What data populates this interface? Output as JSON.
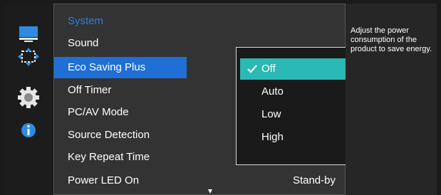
{
  "menu": {
    "header": "System",
    "items": [
      {
        "label": "Sound"
      },
      {
        "label": "Eco Saving Plus"
      },
      {
        "label": "Off Timer"
      },
      {
        "label": "PC/AV Mode"
      },
      {
        "label": "Source Detection"
      },
      {
        "label": "Key Repeat Time"
      },
      {
        "label": "Power LED On",
        "value": "Stand-by"
      }
    ],
    "selected_item": "Eco Saving Plus"
  },
  "submenu": {
    "options": [
      "Off",
      "Auto",
      "Low",
      "High"
    ],
    "selected": "Off"
  },
  "help": {
    "text": "Adjust the power consumption of the product to save energy."
  },
  "sidebar_icons": [
    "monitor-icon",
    "picture-size-icon",
    "gear-icon",
    "info-icon"
  ],
  "colors": {
    "header_text": "#2e7fd8",
    "selection_blue": "#1f6fd6",
    "selection_teal": "#2ab9b4"
  }
}
